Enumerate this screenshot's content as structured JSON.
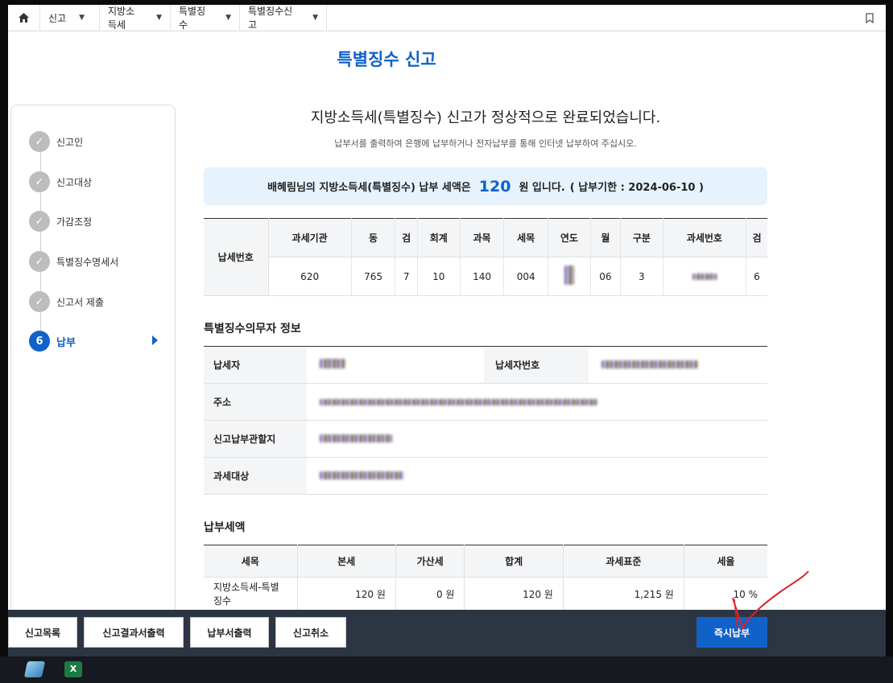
{
  "breadcrumb": {
    "items": [
      "신고",
      "지방소득세",
      "특별징수",
      "특별징수신고"
    ]
  },
  "page_title": "특별징수 신고",
  "steps": [
    {
      "label": "신고인",
      "state": "done"
    },
    {
      "label": "신고대상",
      "state": "done"
    },
    {
      "label": "가감조정",
      "state": "done"
    },
    {
      "label": "특별징수명세서",
      "state": "done"
    },
    {
      "label": "신고서 제출",
      "state": "done"
    },
    {
      "label": "납부",
      "state": "active",
      "number": "6"
    }
  ],
  "complete": {
    "title": "지방소득세(특별징수) 신고가 정상적으로 완료되었습니다.",
    "subtitle": "납부서를 출력하여 은행에 납부하거나 전자납부를 통해 인터넷 납부하여 주십시오."
  },
  "notice": {
    "prefix": "배혜림님의 지방소득세(특별징수) 납부 세액은",
    "amount": "120",
    "suffix": "원 입니다.",
    "due": "( 납부기한 : 2024-06-10 )"
  },
  "tax_number": {
    "row_header": "납세번호",
    "headers": [
      "과세기관",
      "동",
      "검",
      "회계",
      "과목",
      "세목",
      "연도",
      "월",
      "구분",
      "과세번호",
      "검"
    ],
    "values": [
      "620",
      "765",
      "7",
      "10",
      "140",
      "004",
      "",
      "06",
      "3",
      "",
      "6"
    ]
  },
  "obligor": {
    "section_title": "특별징수의무자 정보",
    "labels": {
      "taxpayer": "납세자",
      "taxpayer_no": "납세자번호",
      "address": "주소",
      "jurisdiction": "신고납부관할지",
      "target": "과세대상"
    }
  },
  "amounts": {
    "section_title": "납부세액",
    "headers": [
      "세목",
      "본세",
      "가산세",
      "합계",
      "과세표준",
      "세율"
    ],
    "rows": [
      [
        "지방소득세-특별징수",
        "120 원",
        "0 원",
        "120 원",
        "1,215 원",
        "10 %"
      ]
    ]
  },
  "actions": {
    "list": "신고목록",
    "result_print": "신고결과서출력",
    "bill_print": "납부서출력",
    "cancel": "신고취소",
    "pay_now": "즉시납부"
  },
  "colors": {
    "brand": "#1062c9",
    "notice_bg": "#e6f3fd",
    "actionbar": "#2c3542",
    "annotation": "#e0202a"
  }
}
